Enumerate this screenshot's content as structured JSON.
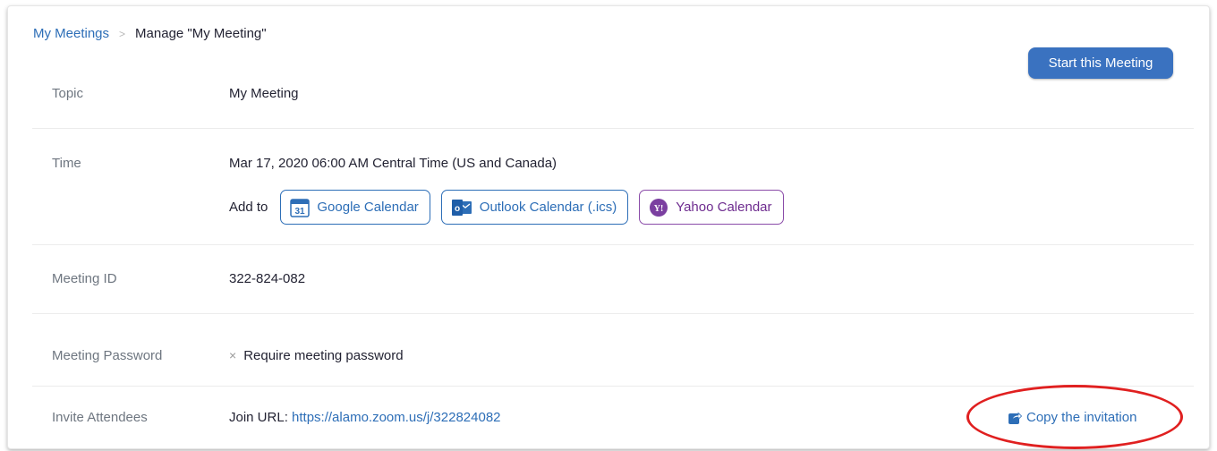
{
  "breadcrumb": {
    "parent": "My Meetings",
    "separator": ">",
    "current": "Manage \"My Meeting\""
  },
  "start_button": "Start this Meeting",
  "rows": {
    "topic": {
      "label": "Topic",
      "value": "My Meeting"
    },
    "time": {
      "label": "Time",
      "value": "Mar 17, 2020 06:00 AM Central Time (US and Canada)",
      "add_to": "Add to",
      "calendars": {
        "google": {
          "label": "Google Calendar",
          "icon_text": "31"
        },
        "outlook": {
          "label": "Outlook Calendar (.ics)",
          "icon_text": "o"
        },
        "yahoo": {
          "label": "Yahoo Calendar",
          "icon_text": "Y!"
        }
      }
    },
    "meeting_id": {
      "label": "Meeting ID",
      "value": "322-824-082"
    },
    "password": {
      "label": "Meeting Password",
      "value": "Require meeting password",
      "mark": "×"
    },
    "invite": {
      "label": "Invite Attendees",
      "join_prefix": "Join URL:",
      "join_url": "https://alamo.zoom.us/j/322824082",
      "copy_label": "Copy the invitation"
    }
  },
  "colors": {
    "link": "#2d6eb7",
    "primary_button": "#3a72c0",
    "yahoo": "#6e2c8f",
    "annotation": "#e02020"
  }
}
